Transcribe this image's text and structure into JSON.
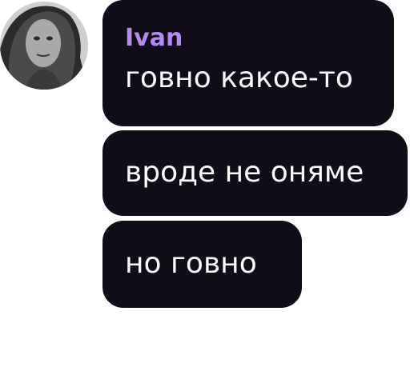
{
  "colors": {
    "bubble_bg": "#110d18",
    "message_text": "#ffffff",
    "sender_name": "#b48cf0",
    "page_bg": "#ffffff"
  },
  "sender": {
    "name": "Ivan",
    "avatar_icon": "user-avatar-photo"
  },
  "messages": [
    {
      "text": "говно какое-то"
    },
    {
      "text": "вроде не оняме"
    },
    {
      "text": "но говно"
    }
  ]
}
